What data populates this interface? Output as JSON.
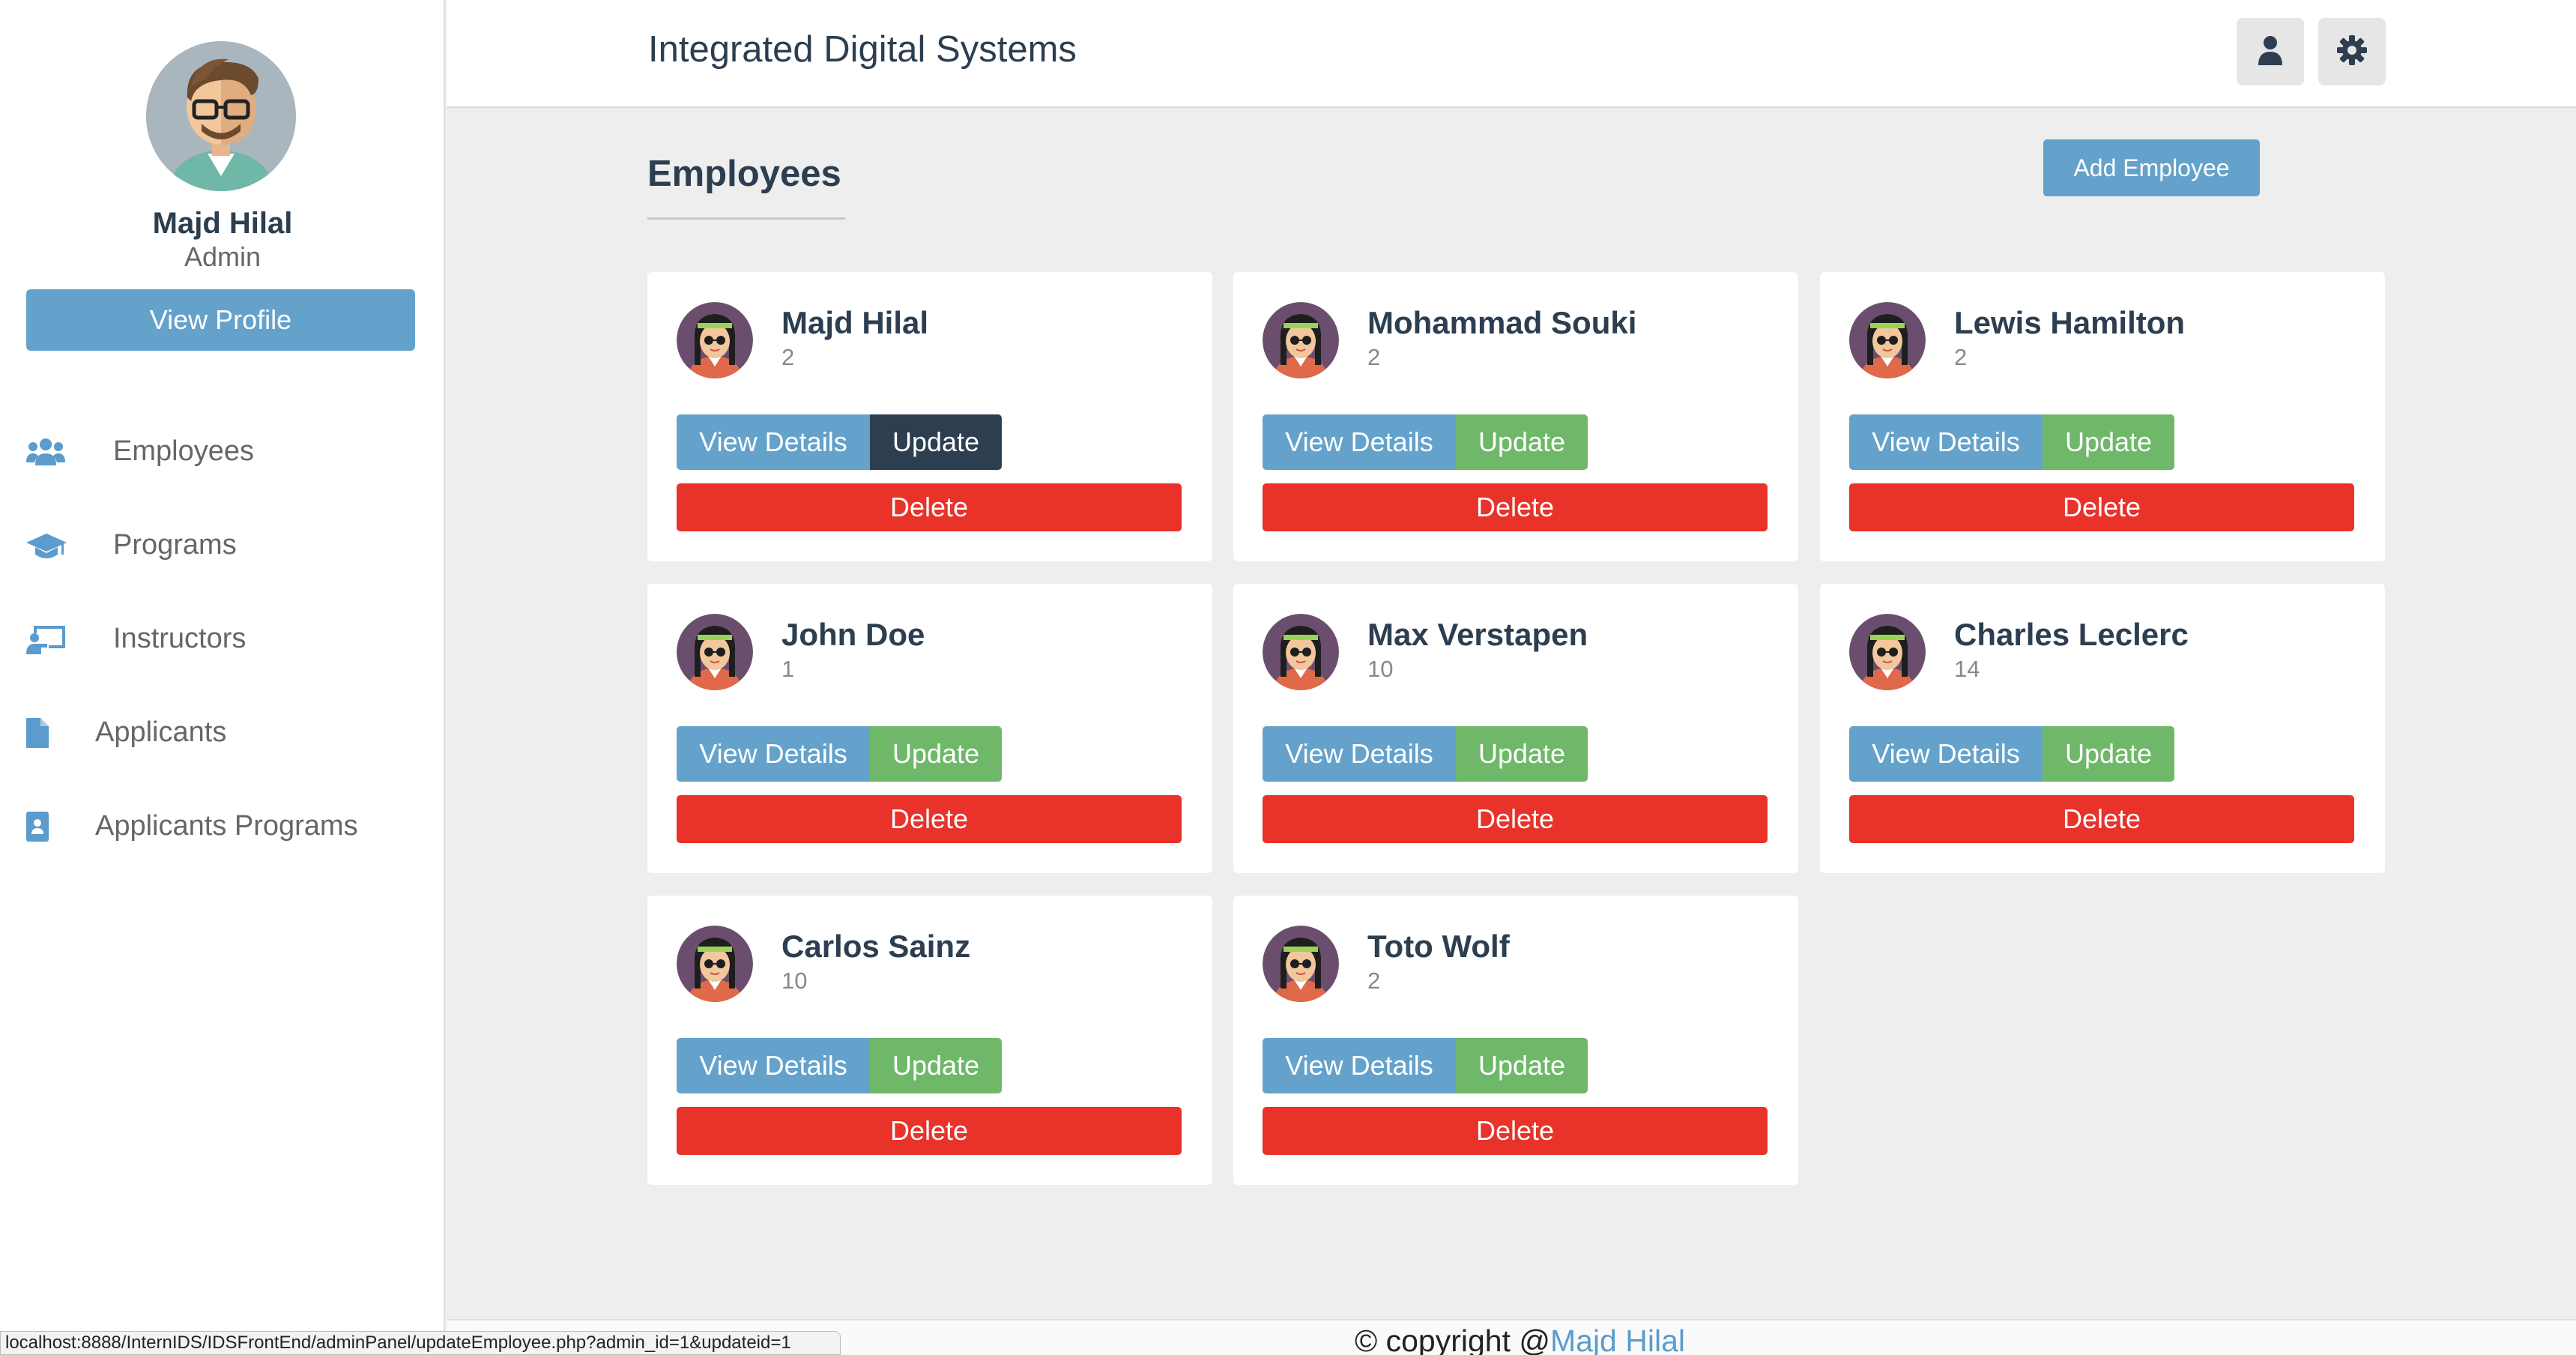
{
  "profile": {
    "name": "Majd Hilal",
    "role": "Admin",
    "view_profile_label": "View Profile"
  },
  "nav": {
    "items": [
      {
        "label": "Employees",
        "icon": "users-icon"
      },
      {
        "label": "Programs",
        "icon": "graduation-cap-icon"
      },
      {
        "label": "Instructors",
        "icon": "chalkboard-teacher-icon"
      },
      {
        "label": "Applicants",
        "icon": "file-icon"
      },
      {
        "label": "Applicants Programs",
        "icon": "id-badge-icon"
      }
    ]
  },
  "header": {
    "title": "Integrated Digital Systems",
    "user_icon": "user-icon",
    "settings_icon": "gear-icon"
  },
  "main": {
    "title": "Employees",
    "add_label": "Add Employee",
    "view_label": "View Details",
    "update_label": "Update",
    "delete_label": "Delete",
    "employees": [
      {
        "name": "Majd Hilal",
        "number": "2"
      },
      {
        "name": "Mohammad Souki",
        "number": "2"
      },
      {
        "name": "Lewis Hamilton",
        "number": "2"
      },
      {
        "name": "John Doe",
        "number": "1"
      },
      {
        "name": "Max Verstapen",
        "number": "10"
      },
      {
        "name": "Charles Leclerc",
        "number": "14"
      },
      {
        "name": "Carlos Sainz",
        "number": "10"
      },
      {
        "name": "Toto Wolf",
        "number": "2"
      }
    ]
  },
  "footer": {
    "prefix": "© copyright @",
    "author": "Majd Hilal"
  },
  "statusbar": {
    "url": "localhost:8888/InternIDS/IDSFrontEnd/adminPanel/updateEmployee.php?admin_id=1&updateid=1"
  },
  "colors": {
    "accent": "#64a2cb",
    "update": "#6fb86a",
    "update_active": "#2c3e50",
    "delete": "#e8322a",
    "text_dark": "#2c3e50"
  }
}
